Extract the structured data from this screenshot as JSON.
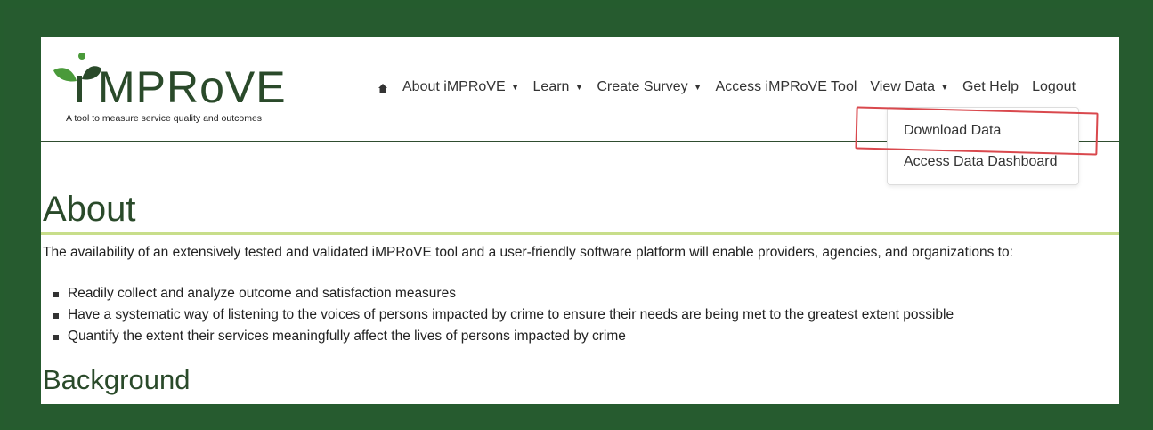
{
  "logo": {
    "text": "iMPRoVE",
    "display": "MPRoVE",
    "tagline": "A tool to measure service quality and outcomes"
  },
  "nav": {
    "items": [
      {
        "label": "About iMPRoVE",
        "caret": true
      },
      {
        "label": "Learn",
        "caret": true
      },
      {
        "label": "Create Survey",
        "caret": true
      },
      {
        "label": "Access iMPRoVE Tool",
        "caret": false
      },
      {
        "label": "View Data",
        "caret": true
      },
      {
        "label": "Get Help",
        "caret": false
      },
      {
        "label": "Logout",
        "caret": false
      }
    ]
  },
  "dropdown": {
    "items": [
      "Download Data",
      "Access Data Dashboard"
    ]
  },
  "content": {
    "heading": "About",
    "paragraph": "The availability of an extensively tested and validated iMPRoVE tool and a user-friendly software platform will enable providers, agencies, and organizations to:",
    "bullets": [
      "Readily collect and analyze outcome and satisfaction measures",
      "Have a systematic way of listening to the voices of persons impacted by crime to ensure their needs are being met to the greatest extent possible",
      "Quantify the extent their services meaningfully affect the lives of persons impacted by crime"
    ],
    "subheading": "Background"
  },
  "colors": {
    "background": "#255c2e",
    "heading": "#2a4a2a",
    "accent_line": "#c8de8a",
    "highlight": "#d9484d"
  }
}
